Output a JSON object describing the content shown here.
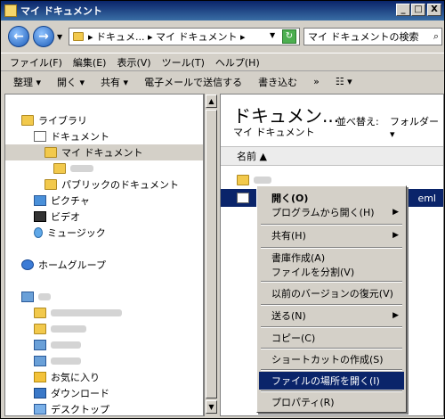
{
  "window": {
    "title": "マイ ドキュメント"
  },
  "titlebar_buttons": [
    "_",
    "□",
    "X"
  ],
  "address": {
    "path": "▸ ドキュメ... ▸ マイ ドキュメント ▸",
    "search_placeholder": "マイ ドキュメントの検索"
  },
  "menubar": [
    "ファイル(F)",
    "編集(E)",
    "表示(V)",
    "ツール(T)",
    "ヘルプ(H)"
  ],
  "toolbar": {
    "organize": "整理 ▾",
    "open": "開く ▾",
    "share": "共有 ▾",
    "email": "電子メールで送信する",
    "burn": "書き込む",
    "more": "»"
  },
  "nav": {
    "libraries": "ライブラリ",
    "documents": "ドキュメント",
    "my_documents": "マイ ドキュメント",
    "public_documents": "パブリックのドキュメント",
    "pictures": "ピクチャ",
    "videos": "ビデオ",
    "music": "ミュージック",
    "homegroup": "ホームグループ",
    "favorites": "お気に入り",
    "downloads": "ダウンロード",
    "desktop": "デスクトップ"
  },
  "content": {
    "title": "ドキュメン...",
    "subtitle": "マイ ドキュメント",
    "sort_label": "並べ替え:",
    "sort_value": "フォルダー ▾",
    "column_name": "名前 ▲",
    "selected_file_ext": "eml"
  },
  "context_menu": {
    "open": "開く(O)",
    "open_with": "プログラムから開く(H)",
    "share": "共有(H)",
    "create_archive": "書庫作成(A)",
    "split_file": "ファイルを分割(V)",
    "restore_prev": "以前のバージョンの復元(V)",
    "send_to": "送る(N)",
    "copy": "コピー(C)",
    "create_shortcut": "ショートカットの作成(S)",
    "open_location": "ファイルの場所を開く(I)",
    "properties": "プロパティ(R)"
  }
}
